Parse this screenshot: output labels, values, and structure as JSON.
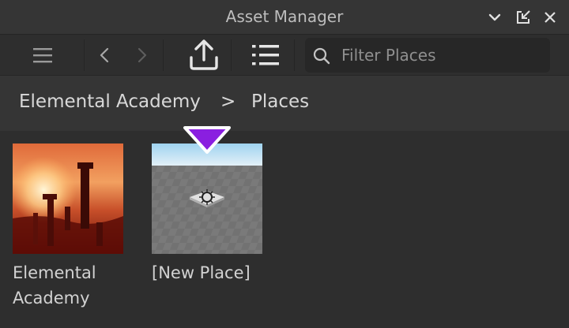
{
  "window": {
    "title": "Asset Manager",
    "controls": [
      "chevron-down-icon",
      "undock-icon",
      "close-icon"
    ]
  },
  "toolbar": {
    "buttons": [
      "menu-icon",
      "back-icon",
      "forward-icon",
      "upload-icon",
      "list-view-icon"
    ]
  },
  "search": {
    "placeholder": "Filter Places",
    "value": ""
  },
  "breadcrumb": {
    "root": "Elemental Academy",
    "separator": ">",
    "current": "Places"
  },
  "places": [
    {
      "name": "Elemental Academy"
    },
    {
      "name": "[New Place]"
    }
  ],
  "colors": {
    "accent": "#8a1fe0",
    "background": "#2e2e2e",
    "header": "#353535"
  }
}
